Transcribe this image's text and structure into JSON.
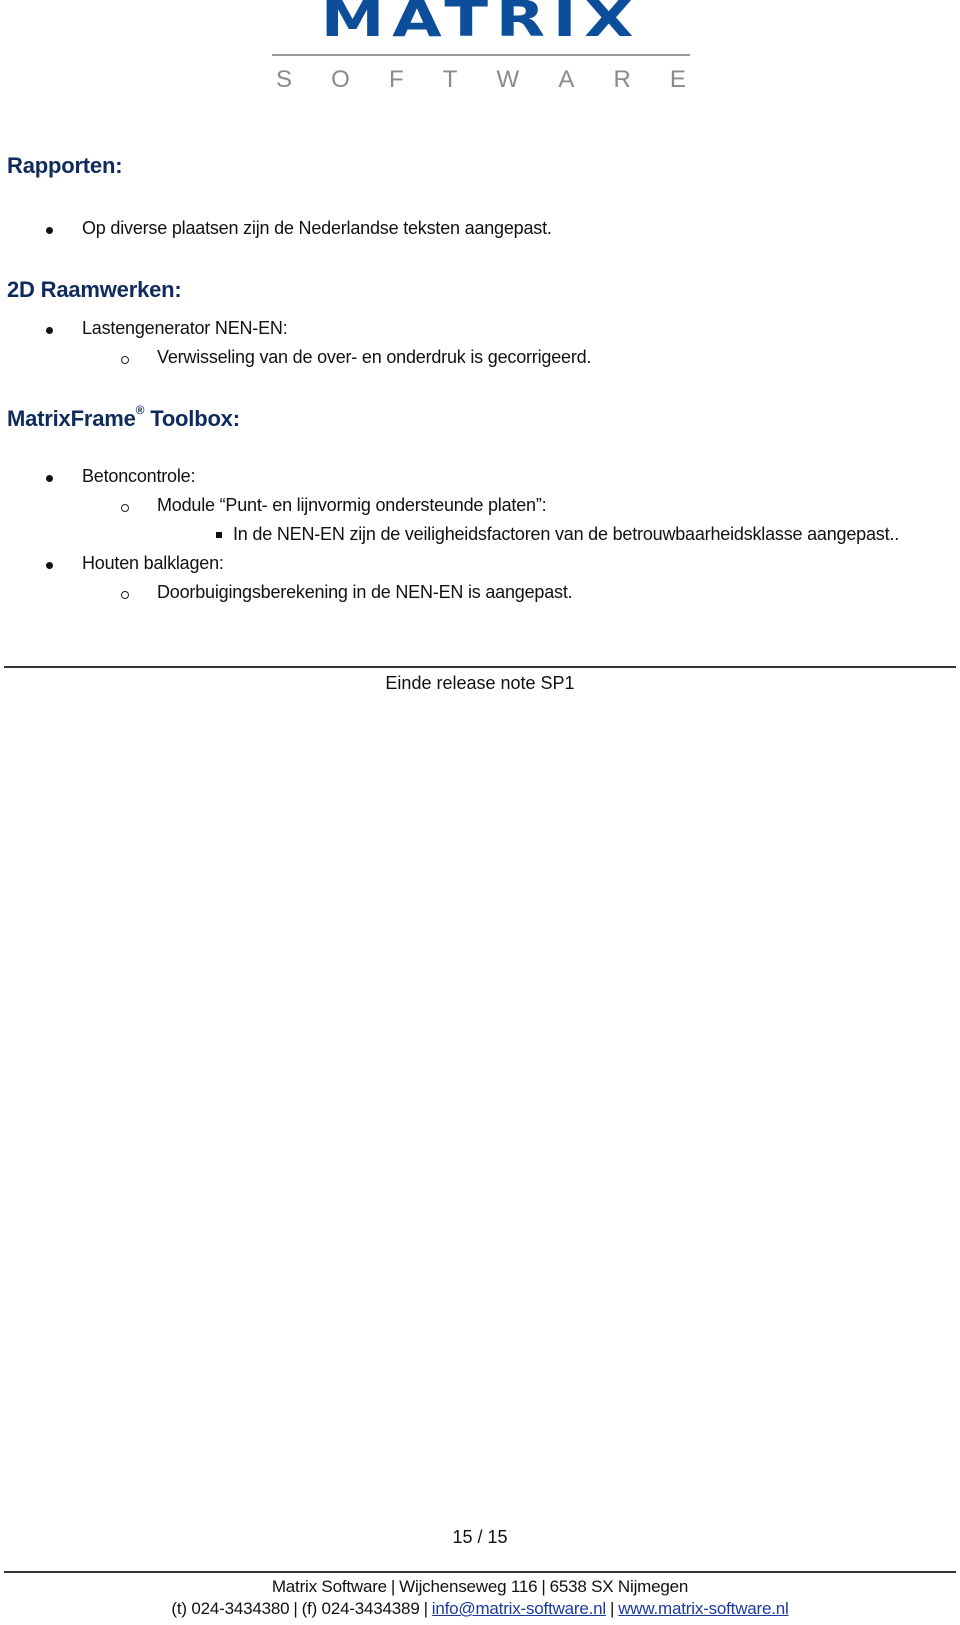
{
  "logo": {
    "word": "MATRIX",
    "sub_letters": [
      "S",
      "O",
      "F",
      "T",
      "W",
      "A",
      "R",
      "E"
    ],
    "brand_color": "#0d4e9b"
  },
  "sections": [
    {
      "heading": "Rapporten:",
      "items": [
        {
          "text": "Op diverse plaatsen zijn de Nederlandse teksten aangepast."
        }
      ]
    },
    {
      "heading": "2D Raamwerken:",
      "items": [
        {
          "text": "Lastengenerator NEN-EN:",
          "sub": [
            {
              "text": "Verwisseling van de over- en onderdruk is gecorrigeerd."
            }
          ]
        }
      ]
    },
    {
      "heading": "MatrixFrame",
      "heading_sup": "®",
      "heading_suffix": " Toolbox:",
      "items": [
        {
          "text": "Betoncontrole:",
          "sub": [
            {
              "text": "Module “Punt- en lijnvormig ondersteunde platen”:",
              "sub": [
                {
                  "text": "In de NEN-EN zijn de veiligheidsfactoren van de betrouwbaarheidsklasse aangepast.."
                }
              ]
            }
          ]
        },
        {
          "text": "Houten balklagen:",
          "sub": [
            {
              "text": "Doorbuigingsberekening in de NEN-EN is aangepast."
            }
          ]
        }
      ]
    }
  ],
  "end_note": "Einde release note SP1",
  "page_number": "15 / 15",
  "footer": {
    "company": "Matrix Software",
    "address": "Wijchenseweg 116",
    "city": "6538 SX Nijmegen",
    "phone": "(t) 024-3434380",
    "fax": "(f) 024-3434389",
    "email": "info@matrix-software.nl",
    "website": "www.matrix-software.nl",
    "separator": "|",
    "link_color": "#1a3aa0"
  }
}
